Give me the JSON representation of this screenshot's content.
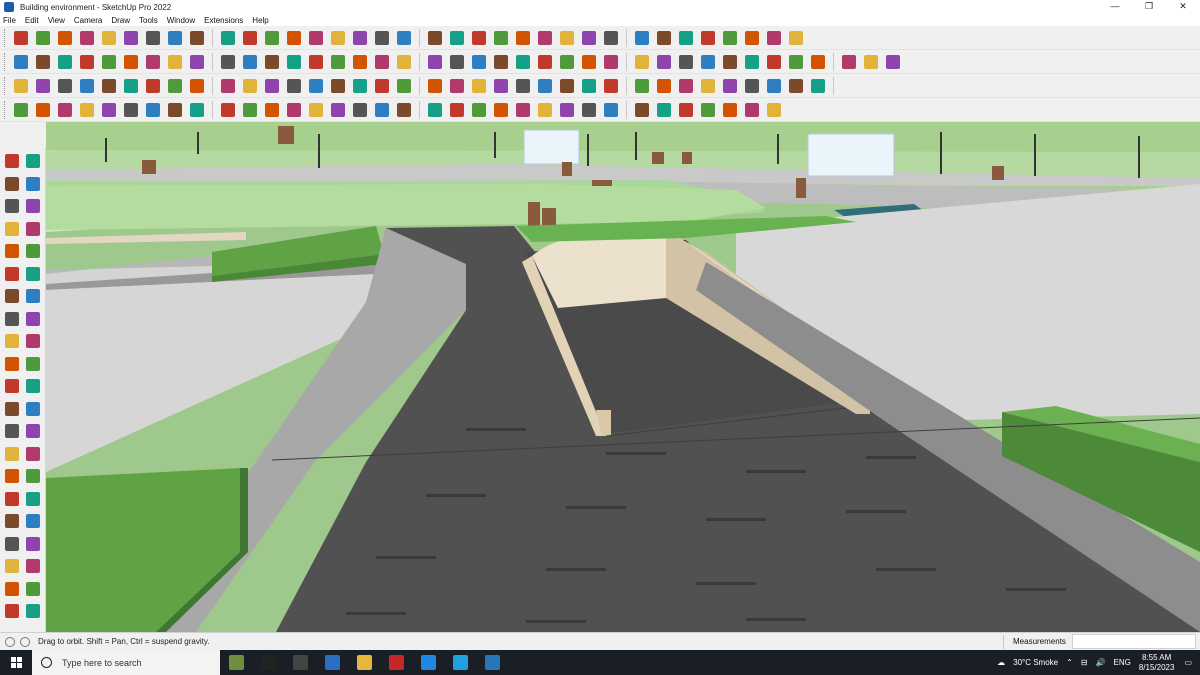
{
  "window": {
    "title": "Building environment - SketchUp Pro 2022",
    "controls": [
      "—",
      "❐",
      "✕"
    ]
  },
  "menu": [
    "File",
    "Edit",
    "View",
    "Camera",
    "Draw",
    "Tools",
    "Window",
    "Extensions",
    "Help"
  ],
  "toolbar_rows": [
    {
      "icons": [
        "zoom-search-icon",
        "select-arrow-icon",
        "eraser-icon",
        "pencil-line-icon",
        "arc-icon",
        "rectangle-icon",
        "push-pull-icon",
        "follow-me-icon",
        "move-icon",
        "rotate-icon",
        "scale-icon",
        "tape-measure-icon",
        "text-label-icon",
        "paint-bucket-icon",
        "orbit-icon",
        "pan-icon",
        "zoom-icon",
        "zoom-extents-icon",
        "sandbox-icon",
        "contours-icon",
        "layers-icon",
        "stack-icon",
        "profile-icon",
        "camera-position-icon",
        "look-around-icon",
        "walk-icon",
        "section-plane-icon",
        "add-location-icon",
        "terrain-icon",
        "flip-icon",
        "arrows-icon",
        "axes-icon",
        "undo-icon",
        "redo-icon",
        "bookmark-icon"
      ]
    },
    {
      "icons": [
        "component-icon",
        "box-icon",
        "material-icon",
        "solid-union-icon",
        "intersect-icon",
        "subtract-icon",
        "trim-icon",
        "split-icon",
        "lasso-icon",
        "warehouse-icon",
        "extension-icon",
        "style-icon",
        "house-icon",
        "house-alt-icon",
        "house-roof-icon",
        "shop-icon",
        "sphere-icon",
        "ruler-icon",
        "circle-icon",
        "oval-icon",
        "cloud-icon",
        "polygon-icon",
        "shape-icon",
        "shape-alt-icon",
        "ellipse-icon",
        "rings-icon",
        "loops-icon",
        "lattice-icon",
        "bezier-icon",
        "plug-icon",
        "knife-icon",
        "eraser-pink-icon",
        "extrude-icon",
        "sweep-icon",
        "mirror-icon",
        "shell-icon",
        "offset-icon",
        "fillet-icon",
        "chamfer-icon"
      ]
    },
    {
      "icons": [
        "grid-blue-icon",
        "diamond-icon",
        "layers-yellow-icon",
        "tag-icon",
        "red-hexagon-icon",
        "dome-icon",
        "arch-icon",
        "rotate-orange-icon",
        "square-red-icon",
        "square-list-icon",
        "door-icon",
        "box-orange-icon",
        "link-icon",
        "curve-red-icon",
        "cross-red-icon",
        "cross-green-icon",
        "x-blue-icon",
        "pyramid-icon",
        "cone-icon",
        "triangle-icon",
        "wedge-icon",
        "spiral-icon",
        "knot-icon",
        "star-icon",
        "plus-blue-icon",
        "box-3d-icon",
        "cube-green-icon",
        "box-pink-icon",
        "lasso-red-icon",
        "grid-red-icon",
        "square-yellow-icon",
        "grid-yellow-icon",
        "ellipse-alt-icon",
        "circle-dashed-icon",
        "chain-icon",
        "grid-dots-icon"
      ]
    },
    {
      "icons": [
        "line-red-icon",
        "curve-dots-icon",
        "cube-small-icon",
        "tile-icon",
        "tile-alt-icon",
        "hook-icon",
        "gear-icon",
        "pipe-icon",
        "corner-icon",
        "stair-icon",
        "cylinder-icon",
        "stool-icon",
        "frame-icon",
        "bars-icon",
        "cage-icon",
        "hand-icon",
        "bend-icon",
        "twist-icon",
        "ribbon-icon",
        "zigzag-icon",
        "hook-red-icon",
        "stairs-icon",
        "gradient-icon",
        "loft-icon",
        "cube-dark-icon",
        "grid-dark-icon",
        "stripe-icon",
        "bars-alt-icon",
        "fence-icon",
        "panel-icon",
        "fan-icon",
        "comb-icon",
        "wave-icon",
        "leaf-icon"
      ]
    }
  ],
  "left_toolbar": {
    "icons": [
      "select-icon",
      "orbit-small-icon",
      "paint-icon",
      "eraser-small-icon",
      "component-small-icon",
      "pencil-small-icon",
      "line-icon",
      "freehand-icon",
      "rectangle-small-icon",
      "rotated-rectangle-icon",
      "circle-small-icon",
      "polygon-small-icon",
      "arc-small-icon",
      "pie-icon",
      "arc-3pt-icon",
      "arc-2pt-icon",
      "push-pull-small-icon",
      "follow-me-small-icon",
      "move-small-icon",
      "rotate-small-icon",
      "scale-small-icon",
      "offset-small-icon",
      "tape-small-icon",
      "dimension-icon",
      "protractor-icon",
      "text-small-icon",
      "axes-small-icon",
      "3d-text-icon",
      "orbit-active-icon",
      "pan-small-icon",
      "zoom-small-icon",
      "zoom-window-icon",
      "zoom-extents-small-icon",
      "previous-view-icon",
      "position-camera-icon",
      "look-around-small-icon",
      "walk-small-icon",
      "section-small-icon",
      "sandbox-small-icon",
      "sandbox-alt-icon",
      "stamp-icon",
      "drape-icon"
    ]
  },
  "status": {
    "hint": "Drag to orbit. Shift = Pan, Ctrl = suspend gravity.",
    "measurements_label": "Measurements",
    "measurements_value": ""
  },
  "taskbar": {
    "search_placeholder": "Type here to search",
    "apps": [
      "minecraft-icon",
      "headset-icon",
      "task-view-icon",
      "calculator-icon",
      "file-explorer-icon",
      "acrobat-icon",
      "store-icon",
      "edge-icon",
      "sketchup-icon"
    ],
    "weather": "30°C  Smoke",
    "language": "ENG",
    "time": "8:55 AM",
    "date": "8/15/2023"
  }
}
